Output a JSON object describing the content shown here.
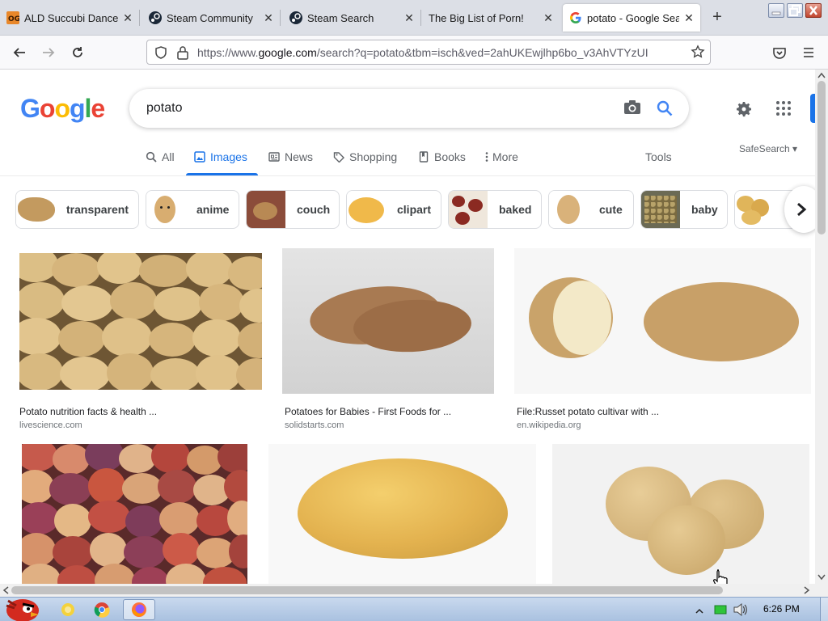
{
  "browser": {
    "tabs": [
      {
        "label": "ALD Succubi Dance",
        "close": "✕",
        "icon": "og-favicon"
      },
      {
        "label": "Steam Community",
        "close": "✕",
        "icon": "steam-favicon"
      },
      {
        "label": "Steam Search",
        "close": "✕",
        "icon": "steam-favicon"
      },
      {
        "label": "The Big List of Porn!",
        "close": "✕",
        "icon": "blank-favicon"
      },
      {
        "label": "potato - Google Search",
        "close": "✕",
        "icon": "google-favicon",
        "active": true
      }
    ],
    "new_tab": "+",
    "url": {
      "prefix": "https://www.",
      "domain": "google.com",
      "rest": "/search?q=potato&tbm=isch&ved=2ahUKEwjlhp6bo_v3AhVTYzUI"
    }
  },
  "google": {
    "logo_letters": [
      "G",
      "o",
      "o",
      "g",
      "l",
      "e"
    ],
    "logo_colors": [
      "#4285f4",
      "#ea4335",
      "#fbbc05",
      "#4285f4",
      "#34a853",
      "#ea4335"
    ],
    "query": "potato",
    "tabs": {
      "all": "All",
      "images": "Images",
      "news": "News",
      "shopping": "Shopping",
      "books": "Books",
      "more": "More",
      "tools": "Tools"
    },
    "safesearch": "SafeSearch ▾",
    "chips": [
      {
        "label": "transparent"
      },
      {
        "label": "anime"
      },
      {
        "label": "couch"
      },
      {
        "label": "clipart"
      },
      {
        "label": "baked"
      },
      {
        "label": "cute"
      },
      {
        "label": "baby"
      },
      {
        "label": "v"
      }
    ],
    "results": [
      {
        "title": "Potato nutrition facts & health ...",
        "source": "livescience.com"
      },
      {
        "title": "Potatoes for Babies - First Foods for ...",
        "source": "solidstarts.com"
      },
      {
        "title": "File:Russet potato cultivar with ...",
        "source": "en.wikipedia.org"
      },
      {
        "title": "",
        "source": ""
      },
      {
        "title": "",
        "source": ""
      },
      {
        "title": "",
        "source": ""
      }
    ]
  },
  "taskbar": {
    "clock": "6:26 PM"
  },
  "colors": {
    "accent": "#1a73e8",
    "tab_strip": "#dcdfe6",
    "potato_light": "#d9b77a",
    "potato_red": "#a7473c"
  }
}
